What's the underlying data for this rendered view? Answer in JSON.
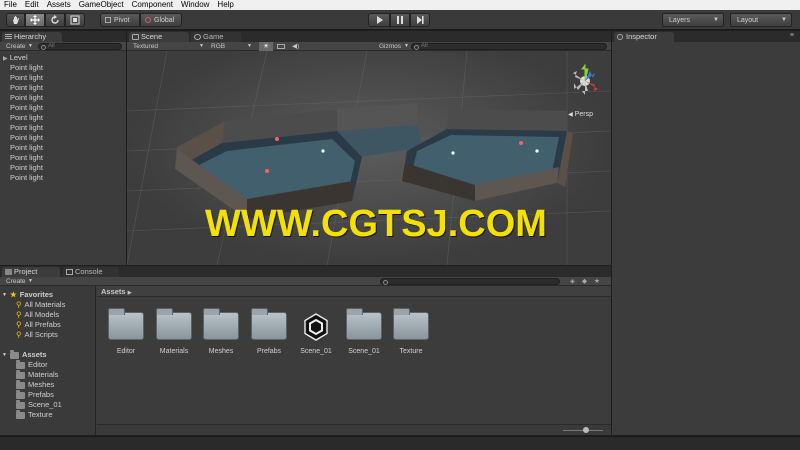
{
  "menu": [
    "File",
    "Edit",
    "Assets",
    "GameObject",
    "Component",
    "Window",
    "Help"
  ],
  "toolbar": {
    "pivot": "Pivot",
    "global": "Global",
    "layers": "Layers",
    "layout": "Layout"
  },
  "hierarchy": {
    "tab": "Hierarchy",
    "create": "Create",
    "search_placeholder": "All",
    "root": "Level",
    "items": [
      "Point light",
      "Point light",
      "Point light",
      "Point light",
      "Point light",
      "Point light",
      "Point light",
      "Point light",
      "Point light",
      "Point light",
      "Point light",
      "Point light"
    ]
  },
  "scene": {
    "tab_scene": "Scene",
    "tab_game": "Game",
    "render_mode": "Textured",
    "color_mode": "RGB",
    "gizmos": "Gizmos",
    "search_placeholder": "All",
    "persp": "Persp",
    "watermark": "WWW.CGTSJ.COM"
  },
  "inspector": {
    "tab": "Inspector"
  },
  "project": {
    "tab_project": "Project",
    "tab_console": "Console",
    "create": "Create",
    "breadcrumb": "Assets",
    "favorites_label": "Favorites",
    "favorites": [
      "All Materials",
      "All Models",
      "All Prefabs",
      "All Scripts"
    ],
    "assets_label": "Assets",
    "tree": [
      "Editor",
      "Materials",
      "Meshes",
      "Prefabs",
      "Scene_01",
      "Texture"
    ],
    "grid": [
      {
        "name": "Editor",
        "kind": "folder"
      },
      {
        "name": "Materials",
        "kind": "folder"
      },
      {
        "name": "Meshes",
        "kind": "folder"
      },
      {
        "name": "Prefabs",
        "kind": "folder"
      },
      {
        "name": "Scene_01",
        "kind": "unity"
      },
      {
        "name": "Scene_01",
        "kind": "folder"
      },
      {
        "name": "Texture",
        "kind": "folder"
      }
    ]
  }
}
